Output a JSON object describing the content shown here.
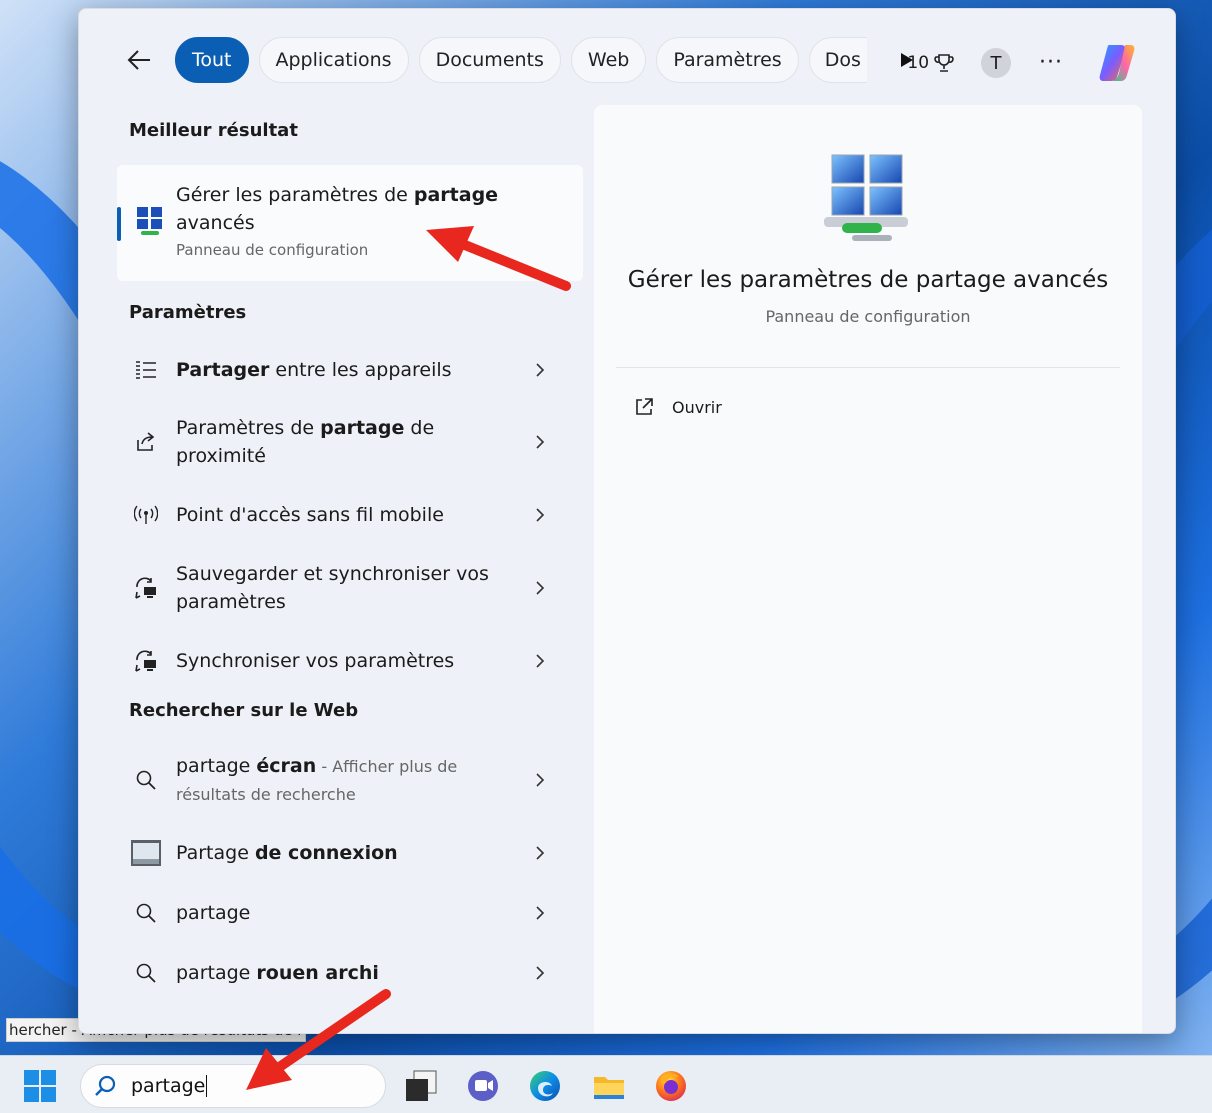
{
  "tabs": {
    "items": [
      {
        "label": "Tout",
        "active": true
      },
      {
        "label": "Applications"
      },
      {
        "label": "Documents"
      },
      {
        "label": "Web"
      },
      {
        "label": "Paramètres"
      },
      {
        "label": "Dos"
      }
    ]
  },
  "top_right": {
    "points": "10",
    "avatar_initial": "T",
    "more": "···"
  },
  "left": {
    "best_header": "Meilleur résultat",
    "best": {
      "title_pre": "Gérer les paramètres de ",
      "title_bold": "partage",
      "title_line2": "avancés",
      "subtitle": "Panneau de configuration"
    },
    "settings_header": "Paramètres",
    "settings": [
      {
        "bold": "Partager",
        "rest": " entre les appareils"
      },
      {
        "pre": "Paramètres de ",
        "bold": "partage",
        "rest": " de",
        "line2": "proximité"
      },
      {
        "text": "Point d'accès sans fil mobile"
      },
      {
        "text": "Sauvegarder et synchroniser vos",
        "line2": "paramètres"
      },
      {
        "text": "Synchroniser vos paramètres"
      }
    ],
    "web_header": "Rechercher sur le Web",
    "web": [
      {
        "pre": "partage ",
        "bold": "écran",
        "gray": " - Afficher plus de",
        "gray2": "résultats de recherche"
      },
      {
        "pre": "Partage ",
        "bold": "de connexion"
      },
      {
        "text": "partage"
      },
      {
        "pre": "partage ",
        "bold": "rouen archi"
      }
    ]
  },
  "right": {
    "title": "Gérer les paramètres de partage avancés",
    "subtitle": "Panneau de configuration",
    "open_label": "Ouvrir"
  },
  "desktop": {
    "tooltip": "hercher - Afficher plus de résultats de recherche"
  },
  "taskbar": {
    "search_value": "partage"
  },
  "colors": {
    "accent": "#0a5fb4",
    "annotation_arrow": "#e8281e"
  }
}
